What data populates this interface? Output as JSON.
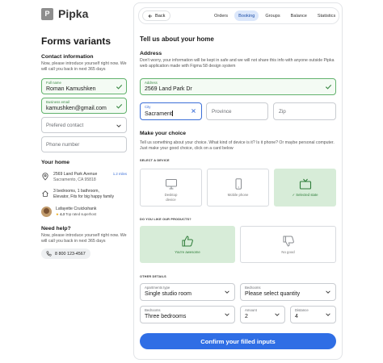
{
  "brand": {
    "logo_letter": "P",
    "name": "Pipka"
  },
  "left": {
    "title": "Forms variants",
    "contact": {
      "title": "Contact information",
      "description": "Now, please introduce yourself right now. We will call you back in next 365 days",
      "full_name_label": "Full name",
      "full_name_value": "Roman Kamushken",
      "email_label": "Business email",
      "email_value": "kamushken@gmail.com",
      "preferred_contact_placeholder": "Prefered contact",
      "phone_placeholder": "Phone number"
    },
    "your_home": {
      "title": "Your home",
      "address_line1": "2569 Land Park Avenue",
      "address_line2": "Sacramento, CA 95818",
      "open_link": "1.2 miles",
      "details_line1": "3 bedrooms, 1 bathroom,",
      "details_line2": "Elevator, Fits for big happy family",
      "host_name": "Lafayette Cruickshank",
      "host_star": "★",
      "host_rating": "4.3",
      "host_badge": "Top rated superhost"
    },
    "help": {
      "title": "Need help?",
      "description": "Now, please introduce yourself right now. We will call you back in next 365 days",
      "phone": "8 800 123-4567"
    }
  },
  "nav": {
    "back_label": "Back",
    "tabs": [
      {
        "label": "Orders"
      },
      {
        "label": "Booking"
      },
      {
        "label": "Groups"
      },
      {
        "label": "Balance"
      },
      {
        "label": "Statistics"
      }
    ]
  },
  "form": {
    "title": "Tell us about your home",
    "address": {
      "title": "Address",
      "description": "Don't worry, your information will be kept in safe and we will not share this info with anyone outside Pipka web application made with Figma 58 design system",
      "address_label": "Address",
      "address_value": "2569 Land Park Dr",
      "city_label": "City",
      "city_value": "Sacrament",
      "province_placeholder": "Province",
      "zip_placeholder": "Zip"
    },
    "choice": {
      "title": "Make your choice",
      "description": "Tell us something about your choice. What kind of device is it? Is it phone? Or maybe personal computer. Just make your good choice, click on a card below",
      "select_device_title": "SELECT A DEVICE",
      "devices": [
        {
          "label1": "Desktop",
          "label2": "device",
          "icon": "monitor-icon"
        },
        {
          "label1": "Mobile phone",
          "label2": "",
          "icon": "phone-icon"
        },
        {
          "label1": "✓ Selected state",
          "label2": "",
          "icon": "tv-icon"
        }
      ],
      "like_title": "DO YOU LIKE OUR PRODUCTS?",
      "like_options": [
        {
          "label": "You're awesome",
          "icon": "thumbs-up-icon"
        },
        {
          "label": "No good",
          "icon": "thumbs-down-icon"
        }
      ]
    },
    "other": {
      "title": "OTHER DETAILS",
      "apartments_label": "Apartments type",
      "apartments_value": "Single studio room",
      "bedrooms_top_label": "Bedrooms",
      "bedrooms_top_placeholder": "Please select quantity",
      "bedrooms_label": "Bedrooms",
      "bedrooms_value": "Three bedrooms",
      "amount_label": "Amount",
      "amount_value": "2",
      "distance_label": "Distance",
      "distance_value": "4"
    },
    "submit_label": "Confirm your filled inputs"
  },
  "colors": {
    "primary": "#2f6ee5",
    "success": "#62b26d",
    "selected_bg": "#d7ecd8",
    "active_tab_bg": "#dbe7fb"
  }
}
